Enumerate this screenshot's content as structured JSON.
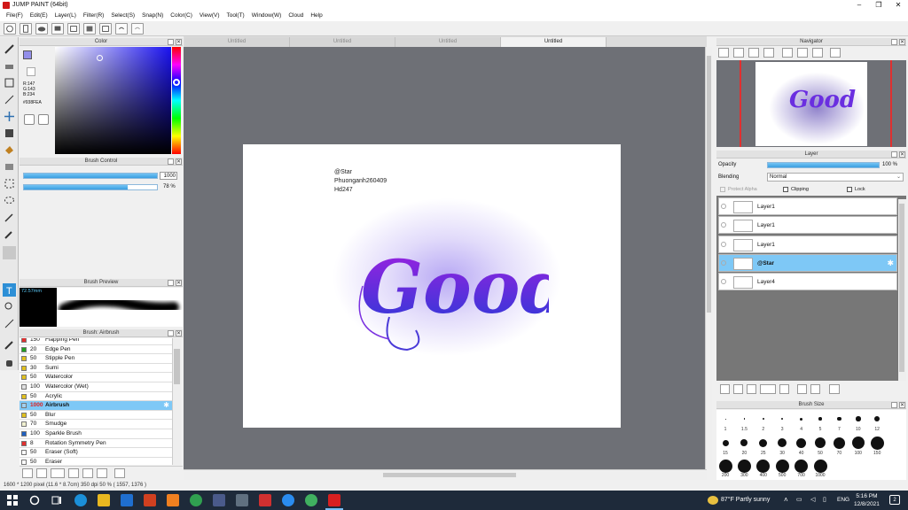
{
  "app": {
    "title": "JUMP PAINT (64bit)"
  },
  "menu": [
    "File(F)",
    "Edit(E)",
    "Layer(L)",
    "Filter(R)",
    "Select(S)",
    "Snap(N)",
    "Color(C)",
    "View(V)",
    "Tool(T)",
    "Window(W)",
    "Cloud",
    "Help"
  ],
  "color_panel": {
    "title": "Color",
    "r": "R:147",
    "g": "G:143",
    "b": "B:234",
    "hex": "#938FEA",
    "current_color": "#938fea"
  },
  "brush_control": {
    "title": "Brush Control",
    "size_value": "1000",
    "opacity_value": "78 %",
    "size_fill": 1.0,
    "opacity_fill": 0.78
  },
  "brush_preview": {
    "title": "Brush Preview",
    "size_label": "72.57mm"
  },
  "brush_list": {
    "title": "Brush: Airbrush",
    "items": [
      {
        "size": "150",
        "name": "Flapping Pen",
        "color": "#e03030"
      },
      {
        "size": "20",
        "name": "Edge Pen",
        "color": "#20a020"
      },
      {
        "size": "50",
        "name": "Stipple Pen",
        "color": "#e0c020"
      },
      {
        "size": "30",
        "name": "Sumi",
        "color": "#e0c020"
      },
      {
        "size": "50",
        "name": "Watercolor",
        "color": "#e0c020"
      },
      {
        "size": "100",
        "name": "Watercolor (Wet)",
        "color": "#e0e0e0"
      },
      {
        "size": "50",
        "name": "Acrylic",
        "color": "#e0c020"
      },
      {
        "size": "1000",
        "name": "Airbrush",
        "color": "#a0d0f0",
        "selected": true
      },
      {
        "size": "50",
        "name": "Blur",
        "color": "#e0c020"
      },
      {
        "size": "70",
        "name": "Smudge",
        "color": "#f0f0d0"
      },
      {
        "size": "100",
        "name": "Sparkle Brush",
        "color": "#2060c0"
      },
      {
        "size": "8",
        "name": "Rotation Symmetry Pen",
        "color": "#e03030"
      },
      {
        "size": "50",
        "name": "Eraser (Soft)",
        "color": "#ffffff"
      },
      {
        "size": "50",
        "name": "Eraser",
        "color": "#ffffff"
      }
    ]
  },
  "doc_tabs": [
    "Untitled",
    "Untitled",
    "Untitled",
    "Untitled"
  ],
  "canvas": {
    "line1": "@Star",
    "line2": "Phuonganh260409",
    "line3": "Hd247",
    "art_text": "Good"
  },
  "navigator": {
    "title": "Navigator",
    "thumb_text": "Good"
  },
  "layer_panel": {
    "title": "Layer",
    "opacity_label": "Opacity",
    "opacity_value": "100 %",
    "blending_label": "Blending",
    "blending_value": "Normal",
    "protect_alpha": "Protect Alpha",
    "clipping": "Clipping",
    "lock": "Lock",
    "layers": [
      {
        "name": "Layer1"
      },
      {
        "name": "Layer1"
      },
      {
        "name": "Layer1"
      },
      {
        "name": "@Star",
        "selected": true
      },
      {
        "name": "Layer4"
      }
    ]
  },
  "brush_size": {
    "title": "Brush Size",
    "labels": [
      "1",
      "1.5",
      "2",
      "3",
      "4",
      "5",
      "7",
      "10",
      "12",
      "15",
      "20",
      "25",
      "30",
      "40",
      "50",
      "70",
      "100",
      "150",
      "200",
      "300",
      "400",
      "500",
      "700",
      "1000"
    ]
  },
  "status": "1600 * 1200 pixel (11.6 * 8.7cm) 350 dpi 50 % ( 1557, 1376 )",
  "taskbar": {
    "weather": "87°F Partly sunny",
    "lang": "ENG",
    "time": "5:16 PM",
    "date": "12/8/2021",
    "notif": "2"
  }
}
